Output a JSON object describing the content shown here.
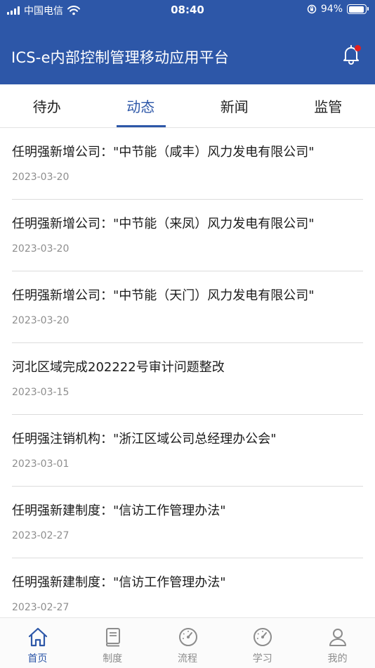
{
  "status_bar": {
    "carrier": "中国电信",
    "time": "08:40",
    "battery": "94%",
    "battery_level": 0.94
  },
  "header": {
    "title": "ICS-e内部控制管理移动应用平台"
  },
  "tabs": [
    {
      "label": "待办"
    },
    {
      "label": "动态"
    },
    {
      "label": "新闻"
    },
    {
      "label": "监管"
    }
  ],
  "active_tab": "动态",
  "feed": [
    {
      "title": "任明强新增公司：\"中节能（咸丰）风力发电有限公司\"",
      "date": "2023-03-20"
    },
    {
      "title": "任明强新增公司：\"中节能（来凤）风力发电有限公司\"",
      "date": "2023-03-20"
    },
    {
      "title": "任明强新增公司：\"中节能（天门）风力发电有限公司\"",
      "date": "2023-03-20"
    },
    {
      "title": "河北区域完成202222号审计问题整改",
      "date": "2023-03-15"
    },
    {
      "title": "任明强注销机构：\"浙江区域公司总经理办公会\"",
      "date": "2023-03-01"
    },
    {
      "title": "任明强新建制度：\"信访工作管理办法\"",
      "date": "2023-02-27"
    },
    {
      "title": "任明强新建制度：\"信访工作管理办法\"",
      "date": "2023-02-27"
    }
  ],
  "bottom_nav": [
    {
      "label": "首页",
      "icon": "home-icon"
    },
    {
      "label": "制度",
      "icon": "book-icon"
    },
    {
      "label": "流程",
      "icon": "gauge-icon"
    },
    {
      "label": "学习",
      "icon": "gauge-icon"
    },
    {
      "label": "我的",
      "icon": "user-icon"
    }
  ],
  "colors": {
    "primary": "#2d57a8",
    "badge": "#e02020",
    "text": "#1b1b1b",
    "muted": "#8e8e8e"
  }
}
